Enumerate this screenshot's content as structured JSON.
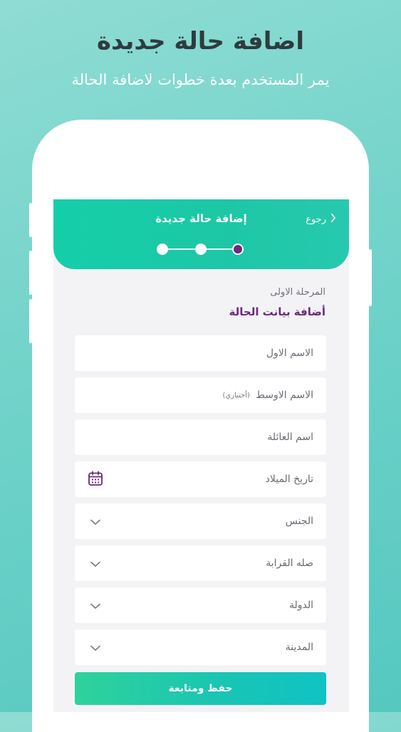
{
  "promo": {
    "title": "اضافة حالة جديدة",
    "subtitle": "يمر المستخدم بعدة خطوات لاضافة الحالة"
  },
  "header": {
    "back_label": "رجوع",
    "title": "إضافة حالة جديدة",
    "steps_total": 3,
    "current_step": 1
  },
  "stage": {
    "label": "المرحلة الاولى",
    "title": "أضافة بيانت الحالة"
  },
  "form": {
    "first_name": "الاسم الاول",
    "middle_name": "الاسم الاوسط",
    "middle_name_optional": "(أختياري)",
    "family_name": "اسم العائلة",
    "birth_date": "تاريخ الميلاد",
    "gender": "الجنس",
    "relationship": "صله القرابة",
    "country": "الدولة",
    "city": "المدينة",
    "submit_label": "حفظ ومتابعة"
  },
  "colors": {
    "header_gradient_start": "#14cfa9",
    "accent_purple": "#6b2a7c",
    "button_gradient_end": "#10c3c4"
  }
}
